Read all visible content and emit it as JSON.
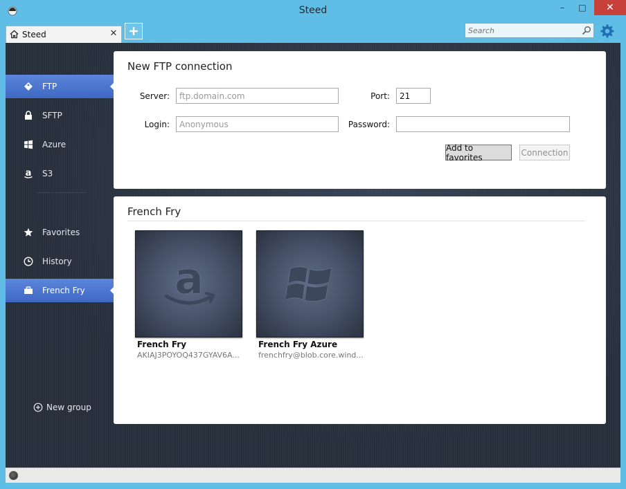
{
  "window": {
    "title": "Steed",
    "minimize_glyph": "–",
    "maximize_glyph": "□",
    "close_glyph": "✕"
  },
  "tabs": [
    {
      "label": "Steed",
      "icon": "home-icon",
      "close_glyph": "✕"
    }
  ],
  "search": {
    "placeholder": "Search"
  },
  "sidebar": {
    "items": [
      {
        "label": "FTP",
        "icon": "tag-icon",
        "selected": true
      },
      {
        "label": "SFTP",
        "icon": "lock-icon",
        "selected": false
      },
      {
        "label": "Azure",
        "icon": "windows-icon",
        "selected": false
      },
      {
        "label": "S3",
        "icon": "amazon-icon",
        "selected": false
      },
      {
        "label": "Favorites",
        "icon": "star-icon",
        "selected": false
      },
      {
        "label": "History",
        "icon": "clock-icon",
        "selected": false
      },
      {
        "label": "French Fry",
        "icon": "briefcase-icon",
        "selected": true
      }
    ],
    "new_group_label": "New group"
  },
  "connection_form": {
    "title": "New FTP connection",
    "server_label": "Server:",
    "server_placeholder": "ftp.domain.com",
    "port_label": "Port:",
    "port_value": "21",
    "login_label": "Login:",
    "login_placeholder": "Anonymous",
    "password_label": "Password:",
    "password_value": "",
    "add_favorites_label": "Add to favorites",
    "connection_label": "Connection"
  },
  "group": {
    "title": "French Fry",
    "favorites": [
      {
        "name": "French Fry",
        "detail": "AKIAJ3POYOQ437GYAV6A...",
        "icon": "amazon-icon"
      },
      {
        "name": "French Fry Azure",
        "detail": "frenchfry@blob.core.wind...",
        "icon": "windows-icon"
      }
    ]
  },
  "colors": {
    "titlebar": "#5fbde6",
    "selected_nav": "#4a74cf",
    "close_button": "#c7403a",
    "background_dark": "#27303c"
  }
}
